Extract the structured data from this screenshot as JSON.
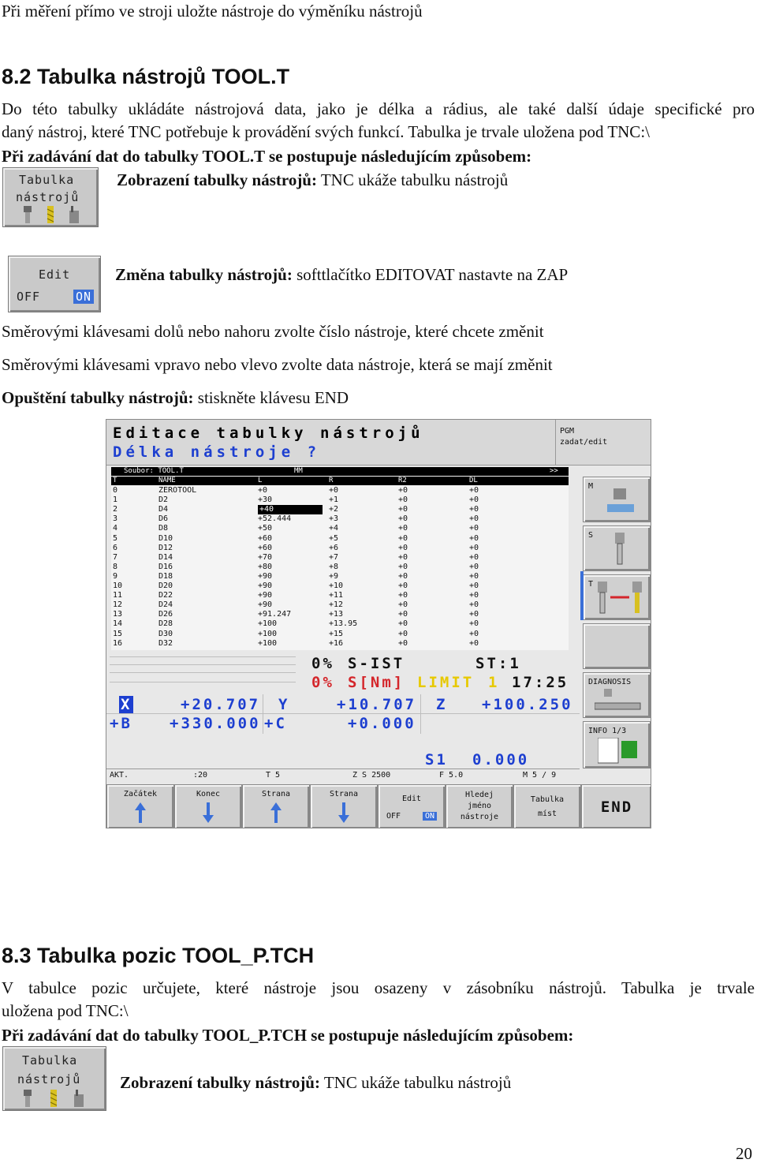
{
  "header_line": "Při měření přímo ve stroji uložte nástroje do výměníku nástrojů",
  "sec82": {
    "title": "8.2  Tabulka nástrojů TOOL.T",
    "p1a": "Do této tabulky ukládáte nástrojová data, jako je délka a rádius, ale také další údaje specifické pro",
    "p1b": "daný nástroj, které TNC potřebuje k provádění svých funkcí. Tabulka je trvale uložena pod TNC:\\",
    "p2": "Při zadávání dat do tabulky TOOL.T se postupuje následujícím způsobem:",
    "step1_bold": "Zobrazení tabulky nástrojů:",
    "step1_text": " TNC ukáže tabulku nástrojů",
    "step2_bold": "Změna tabulky nástrojů:",
    "step2_text": " softtlačítko EDITOVAT nastavte na ZAP",
    "line3": "Směrovými klávesami dolů nebo nahoru zvolte číslo nástroje, které chcete změnit",
    "line4": "Směrovými klávesami vpravo nebo vlevo zvolte data nástroje, která se mají změnit",
    "line5_bold": "Opuštění tabulky nástrojů:",
    "line5_text": " stiskněte klávesu END"
  },
  "softkeys": {
    "tool_table_l1": "Tabulka",
    "tool_table_l2": "nástrojů",
    "edit": "Edit",
    "off": "OFF",
    "on": "ON"
  },
  "tnc": {
    "mode1": "Editace tabulky nástrojů",
    "mode2": "Délka nástroje ?",
    "pgm1": "PGM",
    "pgm2": "zadat/edit",
    "file_label": "Soubor: TOOL.T",
    "file_unit": "MM",
    "file_more": ">>",
    "columns": [
      "T",
      "NAME",
      "L",
      "R",
      "R2",
      "DL"
    ],
    "rows": [
      [
        "0",
        "ZEROTOOL",
        "+0",
        "+0",
        "+0",
        "+0"
      ],
      [
        "1",
        "D2",
        "+30",
        "+1",
        "+0",
        "+0"
      ],
      [
        "2",
        "D4",
        "+40",
        "+2",
        "+0",
        "+0"
      ],
      [
        "3",
        "D6",
        "+52.444",
        "+3",
        "+0",
        "+0"
      ],
      [
        "4",
        "D8",
        "+50",
        "+4",
        "+0",
        "+0"
      ],
      [
        "5",
        "D10",
        "+60",
        "+5",
        "+0",
        "+0"
      ],
      [
        "6",
        "D12",
        "+60",
        "+6",
        "+0",
        "+0"
      ],
      [
        "7",
        "D14",
        "+70",
        "+7",
        "+0",
        "+0"
      ],
      [
        "8",
        "D16",
        "+80",
        "+8",
        "+0",
        "+0"
      ],
      [
        "9",
        "D18",
        "+90",
        "+9",
        "+0",
        "+0"
      ],
      [
        "10",
        "D20",
        "+90",
        "+10",
        "+0",
        "+0"
      ],
      [
        "11",
        "D22",
        "+90",
        "+11",
        "+0",
        "+0"
      ],
      [
        "12",
        "D24",
        "+90",
        "+12",
        "+0",
        "+0"
      ],
      [
        "13",
        "D26",
        "+91.247",
        "+13",
        "+0",
        "+0"
      ],
      [
        "14",
        "D28",
        "+100",
        "+13.95",
        "+0",
        "+0"
      ],
      [
        "15",
        "D30",
        "+100",
        "+15",
        "+0",
        "+0"
      ],
      [
        "16",
        "D32",
        "+100",
        "+16",
        "+0",
        "+0"
      ]
    ],
    "side": [
      "M",
      "S",
      "T",
      "DIAGNOSIS",
      "INFO 1/3"
    ],
    "status": {
      "pct1": "0%",
      "sist": "S-IST",
      "st": "ST:1",
      "pct2": "0%",
      "snm": "S[Nm]",
      "limit": "LIMIT",
      "limit_n": "1",
      "time": "17:25",
      "x_lbl": "X",
      "x_val": "+20.707",
      "y_lbl": "Y",
      "y_val": "+10.707",
      "z_lbl": "Z",
      "z_val": "+100.250",
      "b_lbl": "+B",
      "b_val": "+330.000",
      "c_lbl": "+C",
      "c_val": "+0.000",
      "s1": "S1",
      "s1_val": "0.000",
      "akt": "AKT.",
      "t20": ":20",
      "t5": "T 5",
      "zs": "Z S 2500",
      "f": "F 5.0",
      "m": "M 5 / 9"
    },
    "bottom_keys": {
      "k1": "Začátek",
      "k2": "Konec",
      "k3": "Strana",
      "k4": "Strana",
      "k5a": "Edit",
      "k5off": "OFF",
      "k5on": "ON",
      "k6a": "Hledej",
      "k6b": "jméno",
      "k6c": "nástroje",
      "k7a": "Tabulka",
      "k7b": "míst",
      "k8": "END"
    }
  },
  "sec83": {
    "title": "8.3  Tabulka pozic TOOL_P.TCH",
    "p1a": "V tabulce pozic určujete, které nástroje jsou osazeny v zásobníku nástrojů. Tabulka je trvale",
    "p1b": "uložena pod TNC:\\",
    "p2": "Při zadávání dat do tabulky TOOL_P.TCH se postupuje následujícím způsobem:",
    "step1_bold": "Zobrazení tabulky nástrojů:",
    "step1_text": " TNC ukáže tabulku nástrojů"
  },
  "page_number": "20"
}
